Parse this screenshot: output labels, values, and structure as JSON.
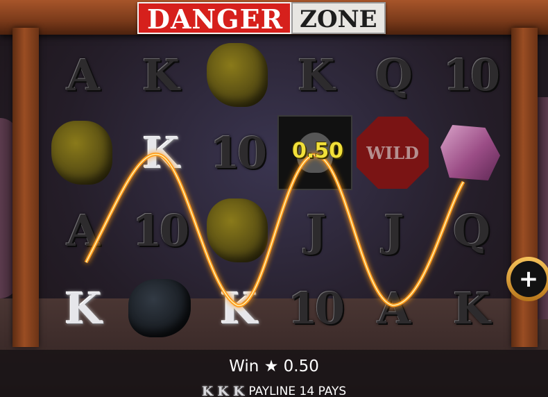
{
  "logo": {
    "part1": "DANGER",
    "part2": "ZONE"
  },
  "reels": [
    [
      "A",
      "K",
      "stone",
      "K",
      "Q",
      "10"
    ],
    [
      "stone",
      "K",
      "10",
      "skull",
      "WILD",
      "crystal"
    ],
    [
      "A",
      "10",
      "stone",
      "J",
      "J",
      "Q"
    ],
    [
      "K",
      "coal",
      "K",
      "10",
      "A",
      "K"
    ]
  ],
  "win_amount": "0.50",
  "footer": {
    "win_label": "Win",
    "win_star": "★",
    "win_value": "0.50",
    "payline_symbols": [
      "K",
      "K",
      "K"
    ],
    "payline_text": "PAYLINE 14 PAYS"
  },
  "buttons": {
    "plus": "+"
  },
  "colors": {
    "payline": "#ff9a1a",
    "win_text": "#f1e03a",
    "logo_red": "#d6201c"
  }
}
